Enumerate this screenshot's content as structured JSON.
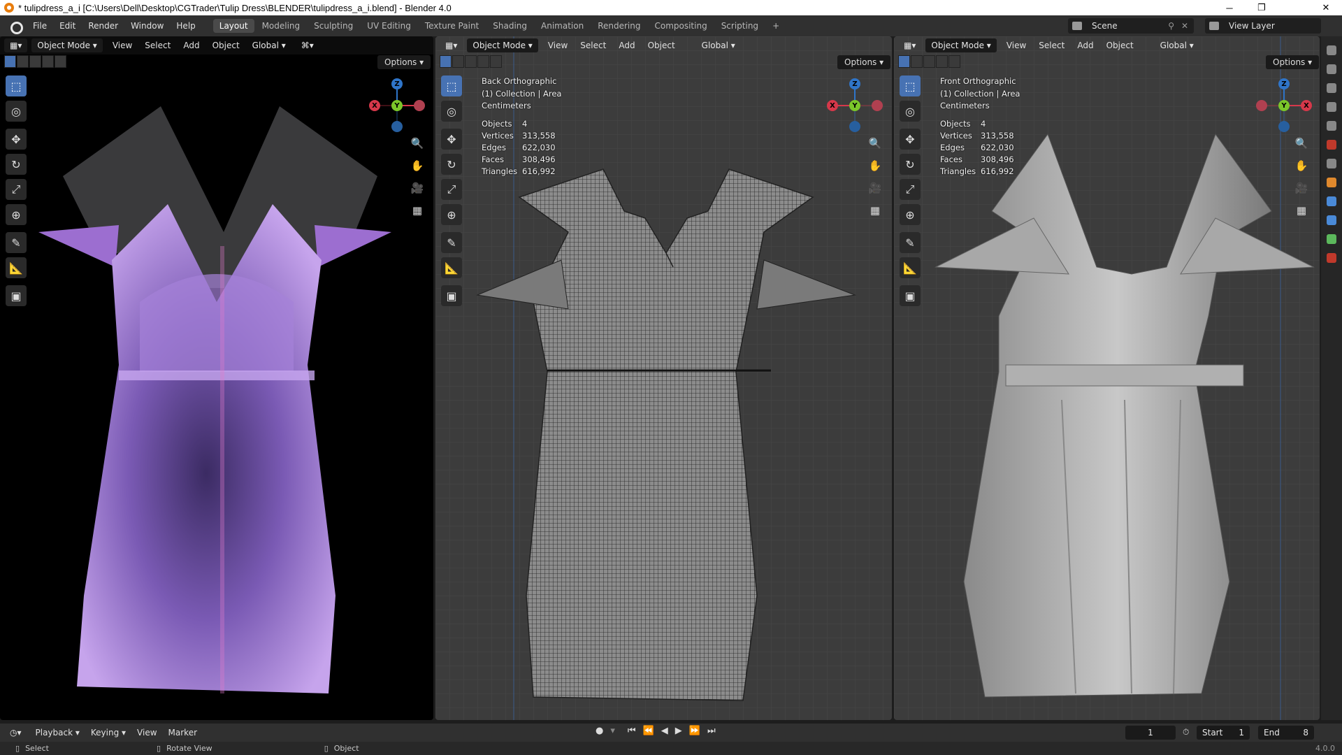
{
  "window": {
    "title": "* tulipdress_a_i [C:\\Users\\Dell\\Desktop\\CGTrader\\Tulip Dress\\BLENDER\\tulipdress_a_i.blend] - Blender 4.0",
    "minimize": "─",
    "maximize": "❐",
    "close": "✕"
  },
  "menus": [
    "File",
    "Edit",
    "Render",
    "Window",
    "Help"
  ],
  "workspaces": [
    "Layout",
    "Modeling",
    "Sculpting",
    "UV Editing",
    "Texture Paint",
    "Shading",
    "Animation",
    "Rendering",
    "Compositing",
    "Scripting"
  ],
  "active_workspace": "Layout",
  "add_workspace": "+",
  "scene": {
    "label": "Scene",
    "view_layer": "View Layer"
  },
  "viewport_header": {
    "mode": "Object Mode",
    "menus": [
      "View",
      "Select",
      "Add",
      "Object"
    ],
    "orientation": "Global",
    "options": "Options"
  },
  "viewports": [
    {
      "name": "rendered",
      "view": "",
      "collection": "",
      "units": "",
      "stats": null
    },
    {
      "name": "wireframe",
      "view": "Back Orthographic",
      "collection": "(1) Collection | Area",
      "units": "Centimeters",
      "stats": {
        "Objects": "4",
        "Vertices": "313,558",
        "Edges": "622,030",
        "Faces": "308,496",
        "Triangles": "616,992"
      }
    },
    {
      "name": "solid",
      "view": "Front Orthographic",
      "collection": "(1) Collection | Area",
      "units": "Centimeters",
      "stats": {
        "Objects": "4",
        "Vertices": "313,558",
        "Edges": "622,030",
        "Faces": "308,496",
        "Triangles": "616,992"
      }
    }
  ],
  "stat_labels": [
    "Objects",
    "Vertices",
    "Edges",
    "Faces",
    "Triangles"
  ],
  "gizmo_axes": {
    "x": "X",
    "y": "Y",
    "z": "Z"
  },
  "timeline": {
    "menus": [
      "Playback",
      "Keying",
      "View",
      "Marker"
    ],
    "current_frame": "1",
    "start_label": "Start",
    "start": "1",
    "end_label": "End",
    "end": "8"
  },
  "statusbar": {
    "select": "Select",
    "rotate": "Rotate View",
    "object": "Object",
    "version": "4.0.0"
  },
  "colors": {
    "accent": "#4772b3",
    "x_axis": "#d6384a",
    "y_axis": "#7bc62a",
    "z_axis": "#2f75c9",
    "dress_purple": "#b28de0",
    "viewport_bg": "#3c3c3c"
  }
}
